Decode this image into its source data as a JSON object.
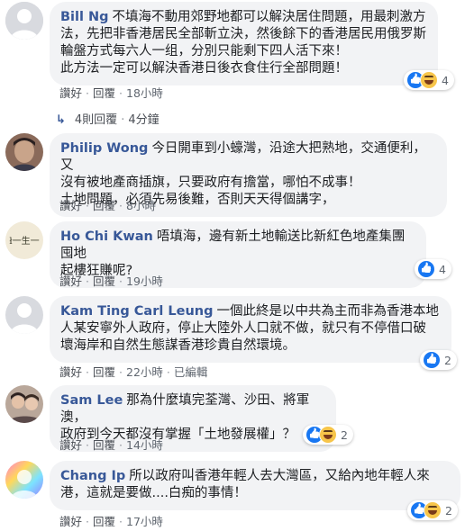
{
  "comments": [
    {
      "author": "Bill Ng",
      "text": "不填海不動用郊野地都可以解決居住問題，用最刺激方\n法，先把非香港居民全部斬立決，然後餘下的香港居民用俄罗斯\n輪盤方式每六人一组，分別只能剩下四人活下來！\n此方法一定可以解決香港日後衣食住行全部問題！",
      "like_label": "讚好",
      "reply_label": "回覆",
      "time": "18小時",
      "reaction_count": "4"
    },
    {
      "author": "Philip Wong",
      "text": "今日開車到小蠔灣，沿途大把熟地，交通便利，又\n沒有被地產商插旗，只要政府有擔當，哪怕不成事！\n土地問題，必須先易後難，否則天天得個講字，",
      "like_label": "讚好",
      "reply_label": "回覆",
      "time": "8小時",
      "reaction_count": ""
    },
    {
      "author": "Ho Chi Kwan",
      "text": "唔填海，邊有新土地輸送比新紅色地產集團囤地\n起樓狂賺呢?",
      "like_label": "讚好",
      "reply_label": "回覆",
      "time": "19小時",
      "reaction_count": "4"
    },
    {
      "author": "Kam Ting Carl Leung",
      "text": "一個此終是以中共為主而非為香港本地\n人某安寧外人政府，停止大陸外人口就不做，就只有不停借口破\n壞海岸和自然生態謀香港珍貴自然環境。",
      "like_label": "讚好",
      "reply_label": "回覆",
      "time": "22小時",
      "edited_label": "已編輯",
      "reaction_count": "2"
    },
    {
      "author": "Sam Lee",
      "text": "那為什麼填完荃灣、沙田、將軍澳，\n政府到今天都沒有掌握「土地發展權」？",
      "like_label": "讚好",
      "reply_label": "回覆",
      "time": "14小時",
      "reaction_count": "2"
    },
    {
      "author": "Chang Ip",
      "text": "所以政府叫香港年輕人去大灣區，又給內地年輕人來\n港，這就是要做....白痴的事情！",
      "like_label": "讚好",
      "reply_label": "回覆",
      "time": "17小時",
      "reaction_count": "2"
    }
  ],
  "replies_row": {
    "label": "4則回覆",
    "time": "4分鐘"
  },
  "colors": {
    "name": "#385898",
    "bubble": "#f2f3f5",
    "meta": "#606770"
  }
}
